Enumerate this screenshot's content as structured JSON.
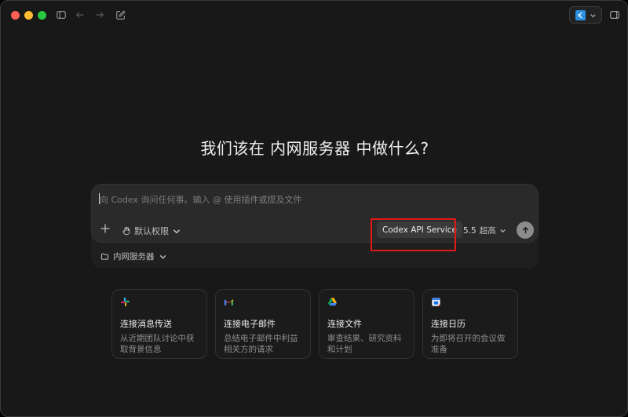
{
  "heading": "我们该在 内网服务器 中做什么?",
  "composer": {
    "placeholder": "向 Codex 询问任何事。输入 @ 使用插件或提及文件",
    "permissions_label": "默认权限",
    "service_label": "Codex API Service",
    "model_version": "5.5",
    "model_level": "超高",
    "folder_label": "内网服务器"
  },
  "cards": [
    {
      "icon": "slack-icon",
      "title": "连接消息传送",
      "desc": "从近期团队讨论中获取背景信息"
    },
    {
      "icon": "gmail-icon",
      "title": "连接电子邮件",
      "desc": "总结电子邮件中利益相关方的请求"
    },
    {
      "icon": "google-drive-icon",
      "title": "连接文件",
      "desc": "审查结果、研究资料和计划"
    },
    {
      "icon": "google-calendar-icon",
      "title": "连接日历",
      "desc": "为即将召开的会议做准备"
    }
  ],
  "colors": {
    "highlight": "#e01818",
    "background": "#181818",
    "composer": "#2a2a2a"
  }
}
